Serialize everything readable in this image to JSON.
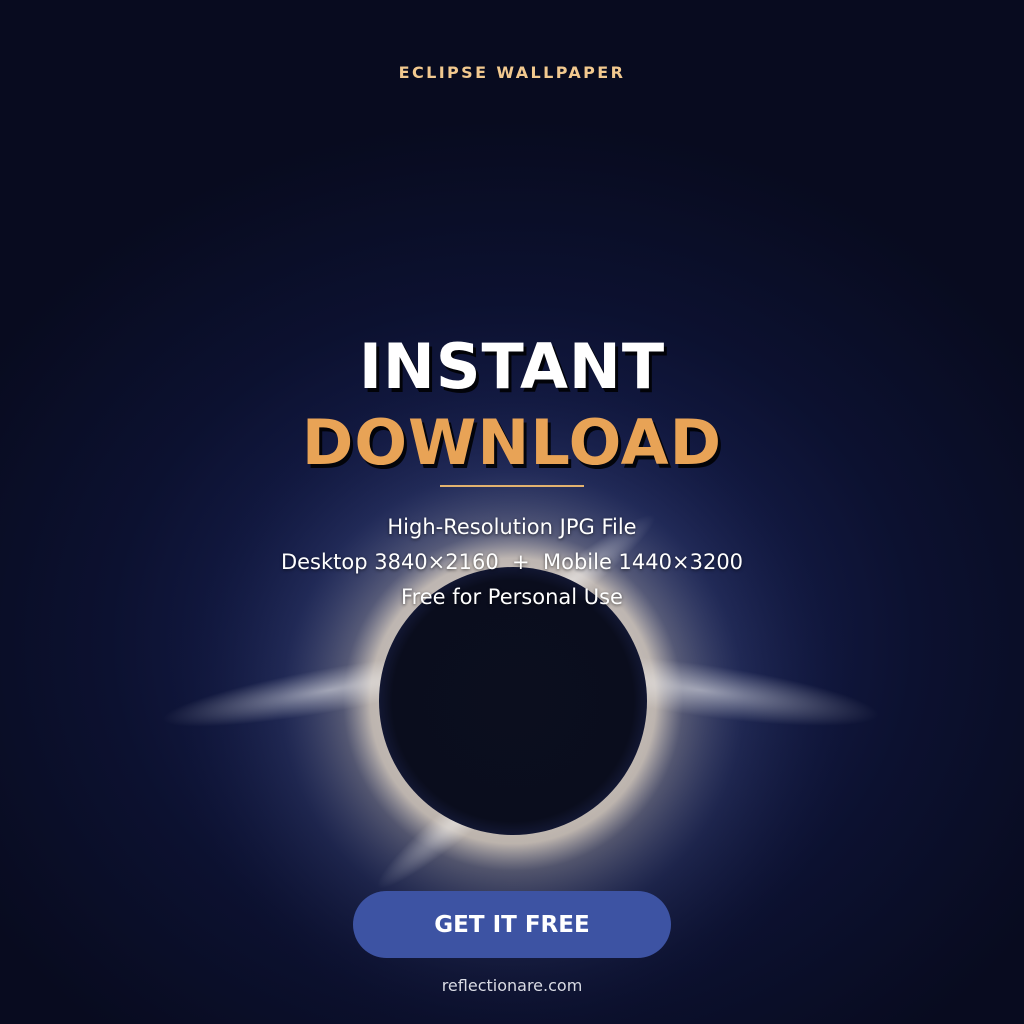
{
  "eyebrow": "ECLIPSE WALLPAPER",
  "headline": {
    "line1": "INSTANT",
    "line2": "DOWNLOAD"
  },
  "details": {
    "line1": "High-Resolution JPG File",
    "line2": "Desktop 3840×2160  +  Mobile 1440×3200",
    "line3": "Free for Personal Use"
  },
  "cta_label": "GET IT FREE",
  "footer_url": "reflectionare.com",
  "colors": {
    "background": "#0a0e24",
    "accent_gold": "#e8a356",
    "eyebrow_gold": "#f2c98f",
    "button_blue": "#3d53a3",
    "text_white": "#ffffff"
  },
  "artwork": "total-solar-eclipse"
}
